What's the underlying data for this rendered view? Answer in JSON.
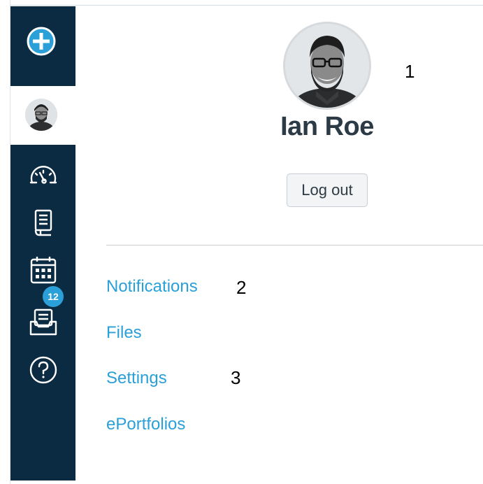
{
  "sidebar": {
    "logo_icon": "plus-circle-icon",
    "items": [
      {
        "icon": "account-avatar-icon",
        "label": ""
      },
      {
        "icon": "dashboard-gauge-icon",
        "label": ""
      },
      {
        "icon": "courses-book-icon",
        "label": ""
      },
      {
        "icon": "calendar-icon",
        "label": ""
      },
      {
        "icon": "inbox-icon",
        "badge": "12"
      },
      {
        "icon": "help-question-icon",
        "label": ""
      }
    ],
    "colors": {
      "background": "#0b2b42",
      "badge": "#2a9fd8"
    }
  },
  "account_tray": {
    "user_name": "Ian Roe",
    "logout_label": "Log out",
    "links": [
      "Notifications",
      "Files",
      "Settings",
      "ePortfolios"
    ],
    "link_color": "#2a9fd8"
  },
  "annotations": {
    "marker_1": "1",
    "marker_2": "2",
    "marker_3": "3"
  }
}
